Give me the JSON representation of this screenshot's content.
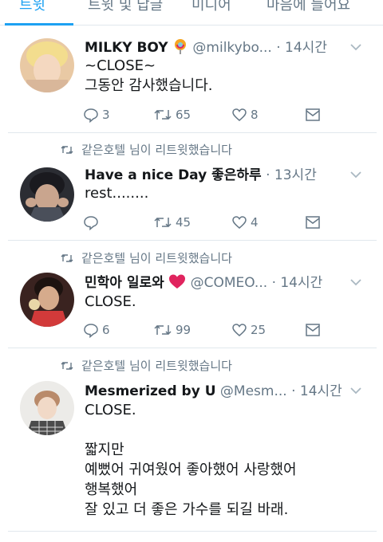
{
  "tabs": [
    {
      "label": "트윗"
    },
    {
      "label": "트윗 및 답글"
    },
    {
      "label": "미디어"
    },
    {
      "label": "마음에 들어요"
    }
  ],
  "tweets": [
    {
      "name": "MILKY BOY",
      "handle": "@milkybo...",
      "time": "· 14시간",
      "lines": [
        "~CLOSE~",
        "그동안 감사했습니다."
      ],
      "replies": "3",
      "retweets": "65",
      "likes": "8"
    },
    {
      "retweet_label": "같은호텔 님이 리트윗했습니다",
      "name": "Have a nice Day 좋은하루",
      "handle": "",
      "time": "· 13시간",
      "lines": [
        "rest........"
      ],
      "replies": "",
      "retweets": "45",
      "likes": "4"
    },
    {
      "retweet_label": "같은호텔 님이 리트윗했습니다",
      "name": "민학아 일로와",
      "handle": "@COMEO...",
      "time": "· 14시간",
      "lines": [
        "CLOSE."
      ],
      "replies": "6",
      "retweets": "99",
      "likes": "25"
    },
    {
      "retweet_label": "같은호텔 님이 리트윗했습니다",
      "name": "Mesmerized by U",
      "handle": "@Mesm...",
      "time": "· 14시간",
      "lines": [
        "CLOSE.",
        "",
        "짧지만",
        "예뻤어 귀여웠어 좋아했어 사랑했어",
        "행복했어",
        "잘 있고 더 좋은 가수를 되길 바래."
      ]
    }
  ],
  "colors": {
    "accent": "#1da1f2",
    "secondary_text": "#657786",
    "divider": "#e1e8ed",
    "heart_emoji": "#e0245e"
  },
  "icons": {
    "reply": "reply-icon",
    "retweet": "retweet-icon",
    "like": "heart-icon",
    "dm": "envelope-icon",
    "more": "chevron-down-icon"
  }
}
